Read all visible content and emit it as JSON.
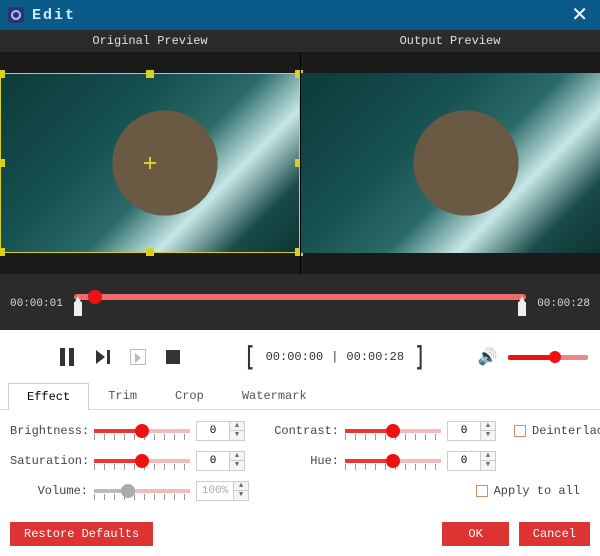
{
  "titlebar": {
    "title": "Edit",
    "close": "✕"
  },
  "preview": {
    "original_label": "Original Preview",
    "output_label": "Output Preview"
  },
  "timeline": {
    "current": "00:00:01",
    "duration": "00:00:28"
  },
  "playback": {
    "in_time": "00:00:00",
    "out_time": "00:00:28",
    "divider": "|"
  },
  "tabs": {
    "effect": "Effect",
    "trim": "Trim",
    "crop": "Crop",
    "watermark": "Watermark"
  },
  "fields": {
    "brightness": {
      "label": "Brightness:",
      "value": "0"
    },
    "contrast": {
      "label": "Contrast:",
      "value": "0"
    },
    "saturation": {
      "label": "Saturation:",
      "value": "0"
    },
    "hue": {
      "label": "Hue:",
      "value": "0"
    },
    "volume": {
      "label": "Volume:",
      "value": "100%"
    }
  },
  "checks": {
    "deinterlacing": "Deinterlacing",
    "apply_all": "Apply to all"
  },
  "buttons": {
    "restore": "Restore Defaults",
    "ok": "OK",
    "cancel": "Cancel"
  }
}
